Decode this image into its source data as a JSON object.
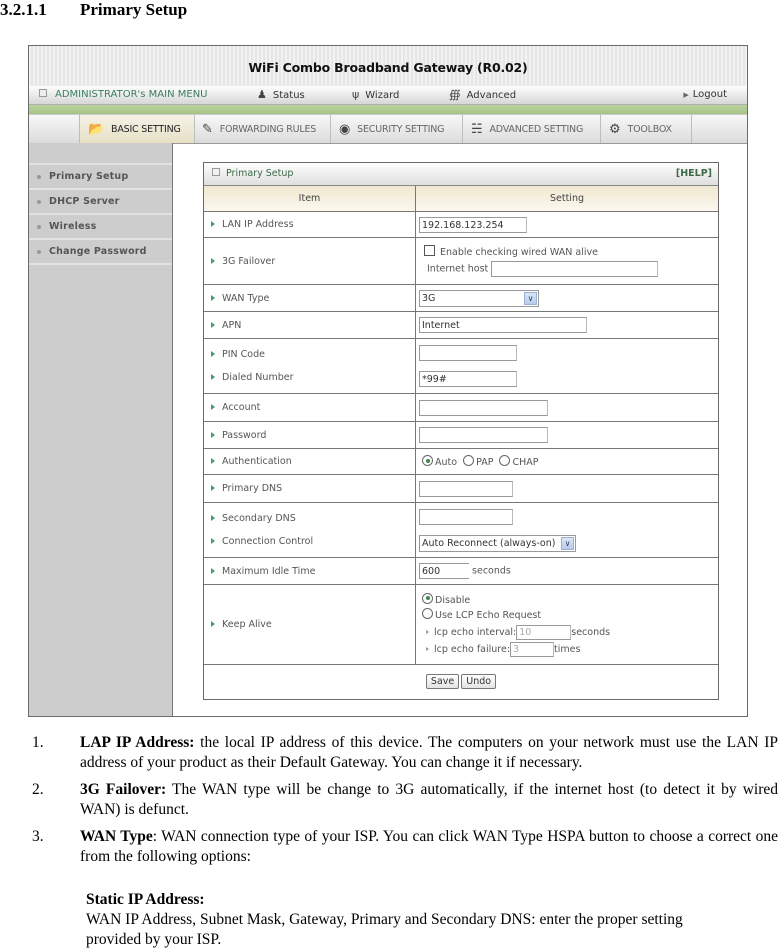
{
  "section": {
    "number": "3.2.1.1",
    "title": "Primary Setup"
  },
  "ui": {
    "title": "WiFi Combo Broadband Gateway (R0.02)",
    "main_menu": {
      "admin_label": "ADMINISTRATOR's MAIN MENU",
      "items": [
        {
          "label": "Status",
          "icon": "status-icon"
        },
        {
          "label": "Wizard",
          "icon": "wizard-icon"
        },
        {
          "label": "Advanced",
          "icon": "advanced-icon"
        }
      ],
      "logout_label": "Logout"
    },
    "tabs": [
      {
        "label": "BASIC SETTING",
        "icon": "basic-setting-icon",
        "active": true
      },
      {
        "label": "FORWARDING RULES",
        "icon": "forwarding-rules-icon",
        "active": false
      },
      {
        "label": "SECURITY SETTING",
        "icon": "security-setting-icon",
        "active": false
      },
      {
        "label": "ADVANCED SETTING",
        "icon": "advanced-setting-icon",
        "active": false
      },
      {
        "label": "TOOLBOX",
        "icon": "toolbox-icon",
        "active": false
      }
    ],
    "sidebar": {
      "items": [
        {
          "label": "Primary Setup"
        },
        {
          "label": "DHCP Server"
        },
        {
          "label": "Wireless"
        },
        {
          "label": "Change Password"
        }
      ]
    },
    "panel": {
      "title": "Primary Setup",
      "help_label": "[HELP]",
      "columns": {
        "item": "Item",
        "setting": "Setting"
      },
      "fields": {
        "lan_ip": {
          "label": "LAN IP Address",
          "value": "192.168.123.254"
        },
        "failover": {
          "label": "3G Failover",
          "checkbox_label": "Enable checking wired WAN alive",
          "checked": false,
          "host_label": "Internet host",
          "host_value": ""
        },
        "wan_type": {
          "label": "WAN Type",
          "value": "3G"
        },
        "apn": {
          "label": "APN",
          "value": "Internet"
        },
        "pin": {
          "label": "PIN Code",
          "value": ""
        },
        "dialed": {
          "label": "Dialed Number",
          "value": "*99#"
        },
        "account": {
          "label": "Account",
          "value": ""
        },
        "password": {
          "label": "Password",
          "value": ""
        },
        "auth": {
          "label": "Authentication",
          "options": [
            "Auto",
            "PAP",
            "CHAP"
          ],
          "selected": "Auto"
        },
        "dns1": {
          "label": "Primary DNS",
          "value": ""
        },
        "dns2": {
          "label": "Secondary DNS",
          "value": ""
        },
        "conn": {
          "label": "Connection Control",
          "value": "Auto Reconnect (always-on)"
        },
        "idle": {
          "label": "Maximum Idle Time",
          "value": "600",
          "unit": "seconds"
        },
        "keepalive": {
          "label": "Keep Alive",
          "options": [
            "Disable",
            "Use LCP Echo Request"
          ],
          "selected": "Disable",
          "interval_label": "lcp echo interval:",
          "interval_value": "10",
          "interval_unit": "seconds",
          "failure_label": "lcp echo failure:",
          "failure_value": "3",
          "failure_unit": "times"
        }
      },
      "save_label": "Save",
      "undo_label": "Undo"
    }
  },
  "doc": {
    "items": [
      {
        "num": "1.",
        "bold": "LAP IP Address:",
        "text": " the local IP address of this device. The computers on your network must use the LAN IP address of your product as their Default Gateway. You can change it if necessary."
      },
      {
        "num": "2.",
        "bold": "3G Failover:",
        "text": " The WAN type will be change to 3G automatically, if the internet host (to detect it by wired WAN) is defunct."
      },
      {
        "num": "3.",
        "bold": "WAN Type",
        "text": ": WAN connection type of your ISP. You can click WAN Type HSPA button to choose a correct one from the following options:"
      }
    ],
    "sub": {
      "title": "Static IP Address:",
      "text": "WAN IP Address, Subnet Mask, Gateway, Primary and Secondary DNS: enter the proper setting provided by your ISP."
    }
  }
}
